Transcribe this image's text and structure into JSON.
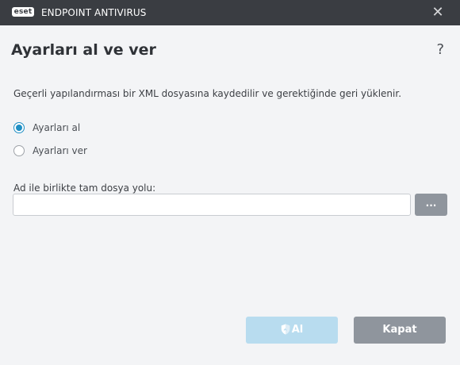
{
  "titlebar": {
    "logo_text": "eset",
    "product_name": "ENDPOINT ANTIVIRUS",
    "close_glyph": "✕"
  },
  "dialog": {
    "title": "Ayarları al ve ver",
    "help_glyph": "?",
    "description": "Geçerli yapılandırması bir XML dosyasına kaydedilir ve gerektiğinde geri yüklenir.",
    "options": [
      {
        "label": "Ayarları al",
        "checked": true
      },
      {
        "label": "Ayarları ver",
        "checked": false
      }
    ],
    "path_field": {
      "label": "Ad ile birlikte tam dosya yolu:",
      "value": "",
      "placeholder": "",
      "browse_label": "..."
    },
    "buttons": {
      "import_label": "Al",
      "import_icon": "shield-icon",
      "close_label": "Kapat"
    }
  },
  "colors": {
    "titlebar_bg": "#3a3d42",
    "accent": "#1f8fc4",
    "primary_disabled": "#b8dcef",
    "secondary_button": "#8f959d",
    "background": "#f3f4f6"
  }
}
